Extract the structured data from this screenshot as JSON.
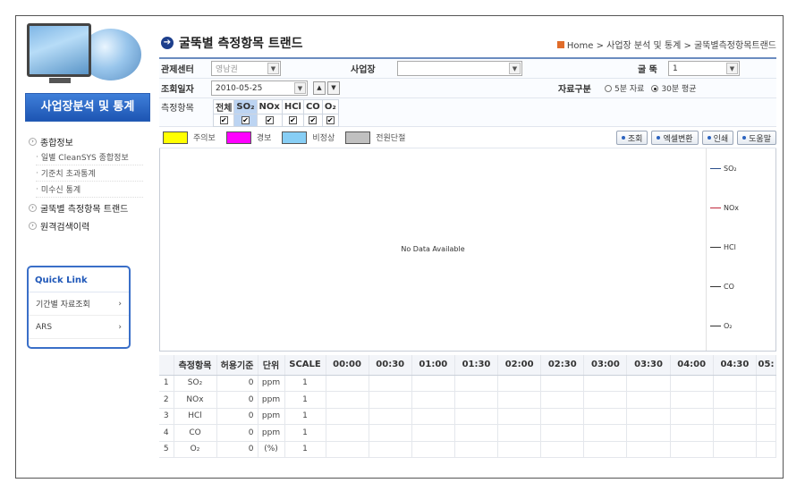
{
  "sidebar": {
    "section_title": "사업장분석 및 통계",
    "menu": [
      {
        "label": "종합정보",
        "children": [
          "일별 CleanSYS 종합정보",
          "기준치 초과통계",
          "미수신 통계"
        ]
      },
      {
        "label": "굴뚝별 측정항목 트랜드",
        "children": []
      },
      {
        "label": "원격검색이력",
        "children": []
      }
    ],
    "quick_link": {
      "title": "Quick Link",
      "items": [
        {
          "label": "기간별 자료조회",
          "arrow": "›"
        },
        {
          "label": "ARS",
          "arrow": "›"
        }
      ]
    }
  },
  "header": {
    "title": "굴뚝별 측정항목 트랜드",
    "breadcrumb": "Home > 사업장 분석 및 통계 > 굴뚝별측정항목트랜드"
  },
  "filter": {
    "center_label": "관제센터",
    "center_value": "영남권",
    "site_label": "사업장",
    "site_value": "",
    "stack_label": "굴 뚝",
    "stack_value": "1",
    "date_label": "조회일자",
    "date_value": "2010-05-25",
    "data_type_label": "자료구분",
    "data_type_options": [
      "5분 자료",
      "30분 평균"
    ],
    "data_type_selected": "30분 평균",
    "items_label": "측정항목",
    "items": [
      {
        "label": "전체",
        "checked": true
      },
      {
        "label": "SO₂",
        "checked": true
      },
      {
        "label": "NOx",
        "checked": true
      },
      {
        "label": "HCl",
        "checked": true
      },
      {
        "label": "CO",
        "checked": true
      },
      {
        "label": "O₂",
        "checked": true
      }
    ]
  },
  "legend": [
    {
      "label": "주의보",
      "color": "#ffff00"
    },
    {
      "label": "경보",
      "color": "#ff00ff"
    },
    {
      "label": "비정상",
      "color": "#87cef5"
    },
    {
      "label": "전원단절",
      "color": "#c0c0c0"
    }
  ],
  "buttons": {
    "search": "조회",
    "excel": "엑셀변환",
    "print": "인쇄",
    "help": "도움말"
  },
  "chart_data": {
    "type": "line",
    "message": "No Data Available",
    "series": [
      {
        "name": "SO₂",
        "color": "#2b4f8c",
        "values": []
      },
      {
        "name": "NOx",
        "color": "#c0283c",
        "values": []
      },
      {
        "name": "HCl",
        "color": "#333333",
        "values": []
      },
      {
        "name": "CO",
        "color": "#333333",
        "values": []
      },
      {
        "name": "O₂",
        "color": "#333333",
        "values": []
      }
    ]
  },
  "table": {
    "headers": [
      "측정항목",
      "허용기준",
      "단위",
      "SCALE",
      "00:00",
      "00:30",
      "01:00",
      "01:30",
      "02:00",
      "02:30",
      "03:00",
      "03:30",
      "04:00",
      "04:30",
      "05:"
    ],
    "rows": [
      {
        "no": "1",
        "item": "SO₂",
        "limit": "0",
        "unit": "ppm",
        "scale": "1"
      },
      {
        "no": "2",
        "item": "NOx",
        "limit": "0",
        "unit": "ppm",
        "scale": "1"
      },
      {
        "no": "3",
        "item": "HCl",
        "limit": "0",
        "unit": "ppm",
        "scale": "1"
      },
      {
        "no": "4",
        "item": "CO",
        "limit": "0",
        "unit": "ppm",
        "scale": "1"
      },
      {
        "no": "5",
        "item": "O₂",
        "limit": "0",
        "unit": "(%)",
        "scale": "1"
      }
    ]
  }
}
